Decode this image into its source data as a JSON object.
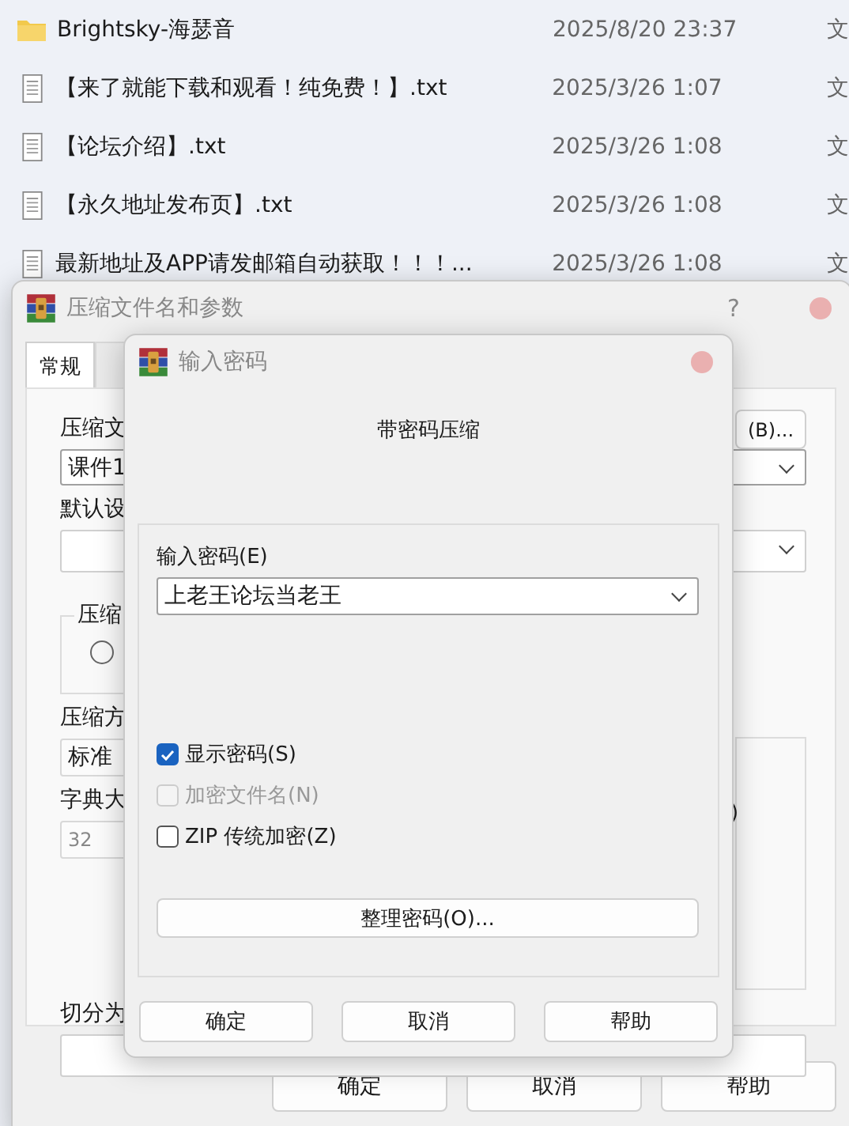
{
  "file_list": [
    {
      "kind": "folder",
      "name": "Brightsky-海瑟音",
      "modified": "2025/8/20 23:37",
      "type": "文"
    },
    {
      "kind": "text",
      "name": "【来了就能下载和观看！纯免费！】.txt",
      "modified": "2025/3/26 1:07",
      "type": "文"
    },
    {
      "kind": "text",
      "name": "【论坛介绍】.txt",
      "modified": "2025/3/26 1:08",
      "type": "文"
    },
    {
      "kind": "text",
      "name": "【永久地址发布页】.txt",
      "modified": "2025/3/26 1:08",
      "type": "文"
    },
    {
      "kind": "text",
      "name": "最新地址及APP请发邮箱自动获取！！！...",
      "modified": "2025/3/26 1:08",
      "type": "文"
    }
  ],
  "archive_dialog": {
    "title": "压缩文件名和参数",
    "help": "?",
    "tabs": [
      {
        "label": "常规",
        "selected": true
      }
    ],
    "archive_name_label": "压缩文",
    "browse_button": "(B)...",
    "archive_name_value": "课件1",
    "profile_label": "默认设",
    "format_group_label": "压缩",
    "format_radio": {
      "selected": false
    },
    "method_label": "压缩方",
    "method_value": "标准",
    "dictionary_label": "字典大",
    "dictionary_value": "32",
    "options_group_text": ")",
    "split_label": "切分为",
    "buttons": [
      "确定",
      "取消",
      "帮助"
    ]
  },
  "password_dialog": {
    "title": "输入密码",
    "heading": "带密码压缩",
    "password_label": "输入密码(E)",
    "password_value": "上老王论坛当老王",
    "options": [
      {
        "label": "显示密码(S)",
        "checked": true,
        "disabled": false
      },
      {
        "label": "加密文件名(N)",
        "checked": false,
        "disabled": true
      },
      {
        "label": "ZIP 传统加密(Z)",
        "checked": false,
        "disabled": false
      }
    ],
    "organize_button": "整理密码(O)...",
    "buttons": [
      "确定",
      "取消",
      "帮助"
    ]
  }
}
